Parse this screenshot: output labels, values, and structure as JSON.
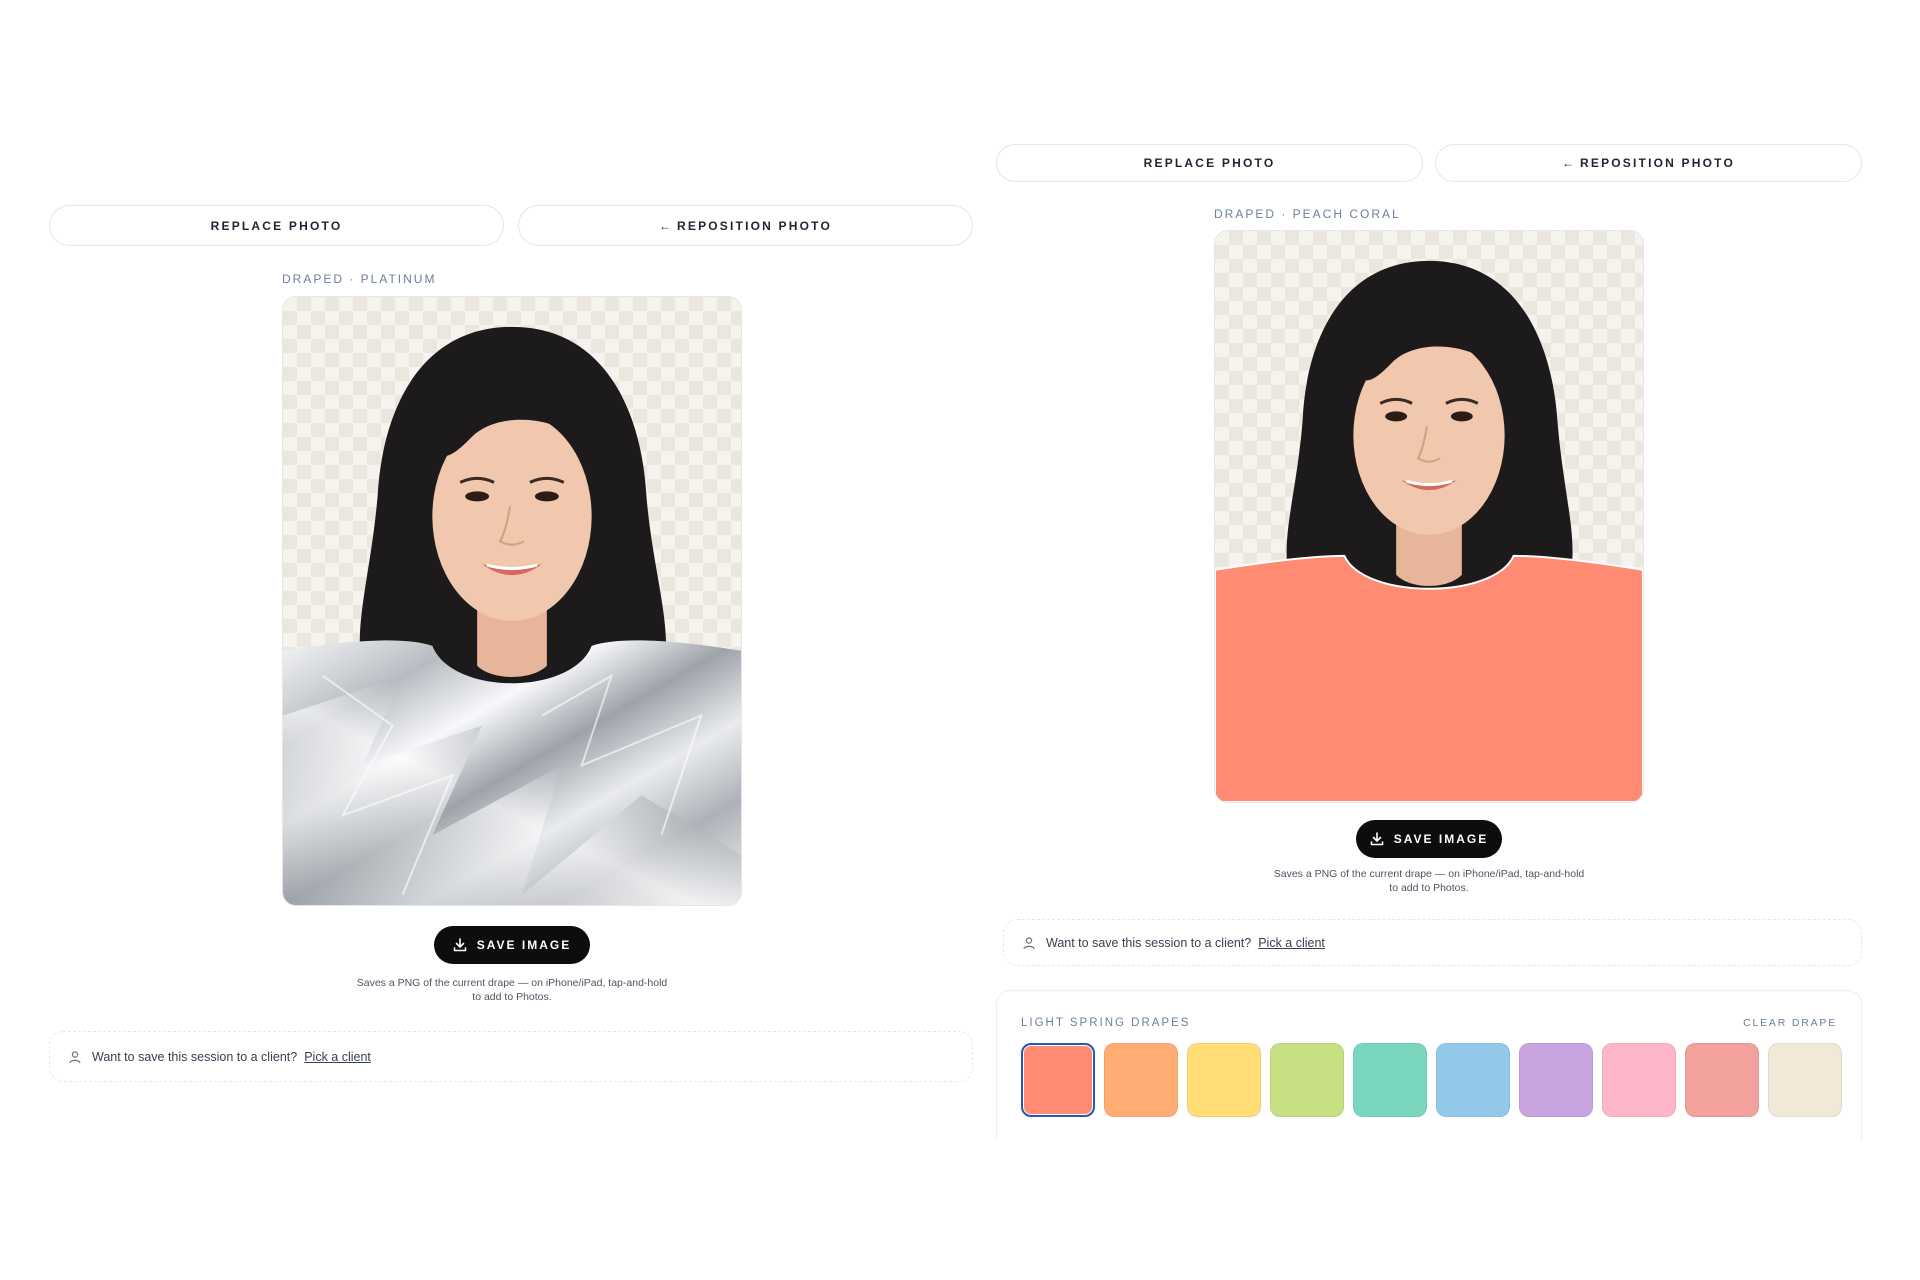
{
  "left_panel": {
    "replace_label": "REPLACE PHOTO",
    "reposition_label": "REPOSITION PHOTO",
    "caption": "DRAPED · PLATINUM",
    "save_label": "SAVE IMAGE",
    "hint_line1": "Saves a PNG of the current drape — on iPhone/iPad, tap-and-hold",
    "hint_line2": "to add to Photos.",
    "client_prompt": "Want to save this session to a client?",
    "client_link": "Pick a client"
  },
  "right_panel": {
    "replace_label": "REPLACE PHOTO",
    "reposition_label": "REPOSITION PHOTO",
    "caption": "DRAPED · PEACH CORAL",
    "save_label": "SAVE IMAGE",
    "hint_line1": "Saves a PNG of the current drape — on iPhone/iPad, tap-and-hold",
    "hint_line2": "to add to Photos.",
    "client_prompt": "Want to save this session to a client?",
    "client_link": "Pick a client",
    "drapes": {
      "title": "LIGHT SPRING DRAPES",
      "clear_label": "CLEAR DRAPE",
      "selected_index": 0,
      "swatches": [
        "#ff8b73",
        "#ffad73",
        "#ffde78",
        "#c6e082",
        "#7ad6bf",
        "#93c9e8",
        "#c8a5e0",
        "#ffb5c8",
        "#f2a29b",
        "#f2e8d8"
      ]
    }
  },
  "icons": {
    "arrow": "arrow-left-icon",
    "save": "download-icon",
    "client": "user-icon"
  },
  "colors": {
    "platinum_drape": "#c9ccd1",
    "peach_coral_drape": "#ff8b73",
    "save_button": "#0d0d0d"
  }
}
